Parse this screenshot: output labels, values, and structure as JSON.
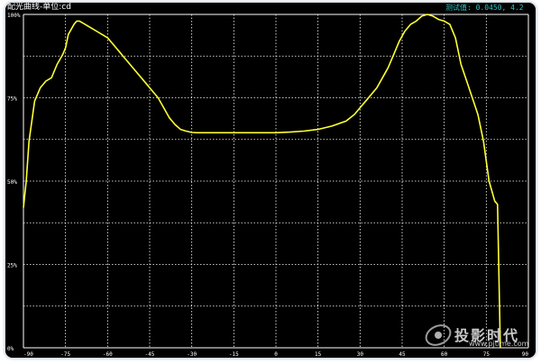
{
  "window": {
    "title": "配光曲线-单位:cd",
    "readout": "测试值: 0.0450, 4.2"
  },
  "watermark": {
    "text": "投影时代",
    "sub": "www.pjtime.com"
  },
  "colors": {
    "background": "#000000",
    "curve": "#ffff33",
    "grid": "#ffffff",
    "readout": "#2ec4c4"
  },
  "chart_data": {
    "type": "line",
    "title": "配光曲线-单位:cd",
    "xlabel": "",
    "ylabel": "",
    "xlim": [
      -90,
      90
    ],
    "ylim": [
      0,
      100
    ],
    "xticks": [
      -90,
      -75,
      -60,
      -45,
      -30,
      -15,
      0,
      15,
      30,
      45,
      60,
      75,
      90
    ],
    "xtick_labels": [
      "-90",
      "-75",
      "-60",
      "-45",
      "-30",
      "-15",
      "0",
      "15",
      "30",
      "45",
      "60",
      "75",
      "90"
    ],
    "yticks": [
      0,
      25,
      50,
      75,
      100
    ],
    "ytick_labels": [
      "0%",
      "25%",
      "50%",
      "75%",
      "100%"
    ],
    "grid": true,
    "legend": "none",
    "series": [
      {
        "values_x": [
          -90,
          -89,
          -88,
          -86,
          -84,
          -82,
          -80,
          -78,
          -76,
          -75,
          -74,
          -72,
          -71,
          -70,
          -68,
          -66,
          -64,
          -62,
          -60,
          -58,
          -56,
          -54,
          -52,
          -50,
          -48,
          -46,
          -44,
          -42,
          -40,
          -38,
          -36,
          -34,
          -32,
          -30,
          -28,
          -25,
          -20,
          -15,
          -10,
          -5,
          0,
          5,
          10,
          15,
          20,
          25,
          28,
          30,
          32,
          34,
          36,
          38,
          40,
          42,
          44,
          46,
          48,
          50,
          52,
          54,
          56,
          58,
          60,
          62,
          64,
          66,
          68,
          70,
          72,
          74,
          76,
          78,
          79,
          80,
          81,
          82,
          84,
          86,
          87,
          88,
          89,
          90,
          90
        ],
        "values_y": [
          42,
          50,
          62,
          74,
          78,
          80,
          81,
          85,
          88,
          90,
          94,
          97,
          98,
          98,
          97,
          96,
          95,
          94,
          93,
          91,
          89,
          87,
          85,
          83,
          81,
          79,
          77,
          75,
          72,
          69,
          67,
          65.5,
          65,
          64.6,
          64.5,
          64.5,
          64.5,
          64.5,
          64.5,
          64.5,
          64.5,
          64.7,
          65,
          65.5,
          66.5,
          68,
          70,
          72,
          74,
          76,
          78,
          81,
          84,
          88,
          92,
          95,
          97,
          98,
          99.5,
          100,
          99.5,
          98.5,
          98,
          97,
          93,
          85,
          80,
          75,
          70,
          62,
          50,
          44,
          43,
          0
        ]
      }
    ]
  }
}
